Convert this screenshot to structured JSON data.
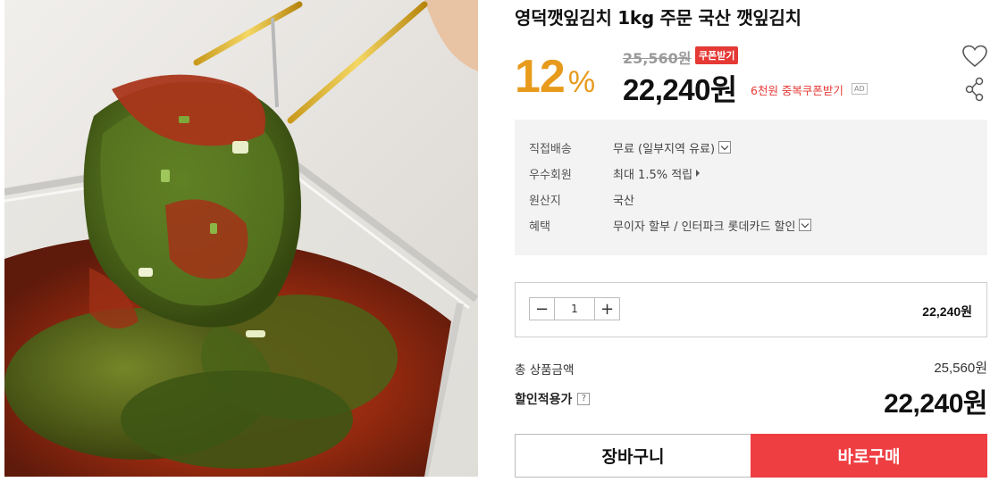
{
  "product": {
    "title": "영덕깻잎김치 1kg 주문 국산 깻잎김치",
    "image_alt": "깻잎김치"
  },
  "pricing": {
    "discount_number": "12",
    "discount_unit": "%",
    "original_price": "25,560원",
    "coupon_badge": "쿠폰받기",
    "sale_price": "22,240원",
    "extra_coupon": "6천원 중복쿠폰받기",
    "ad_label": "AD"
  },
  "icons": {
    "wishlist": "heart-icon",
    "share": "share-icon"
  },
  "info": {
    "rows": [
      {
        "label": "직접배송",
        "value": "무료 (일부지역 유료)",
        "control": "dropdown"
      },
      {
        "label": "우수회원",
        "value": "최대 1.5% 적립",
        "control": "arrow"
      },
      {
        "label": "원산지",
        "value": "국산",
        "control": "none"
      },
      {
        "label": "혜택",
        "value": "무이자 할부 / 인터파크 롯데카드 할인",
        "control": "dropdown"
      }
    ]
  },
  "quantity": {
    "minus": "−",
    "plus": "+",
    "value": "1",
    "line_price": "22,240원"
  },
  "totals": {
    "total_label": "총 상품금액",
    "total_value": "25,560원",
    "final_label": "할인적용가",
    "help_mark": "?",
    "final_value": "22,240원"
  },
  "actions": {
    "cart": "장바구니",
    "buy": "바로구매"
  },
  "colors": {
    "discount": "#e79a1b",
    "accent_red": "#ef3e42",
    "info_bg": "#f3f3f3"
  }
}
